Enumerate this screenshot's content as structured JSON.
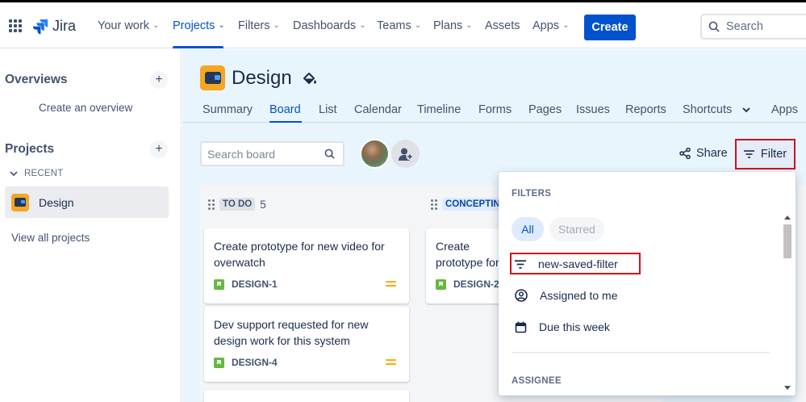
{
  "topnav": {
    "logo_text": "Jira",
    "items": [
      {
        "label": "Your work",
        "has_chevron": true
      },
      {
        "label": "Projects",
        "has_chevron": true,
        "active": true
      },
      {
        "label": "Filters",
        "has_chevron": true
      },
      {
        "label": "Dashboards",
        "has_chevron": true
      },
      {
        "label": "Teams",
        "has_chevron": true
      },
      {
        "label": "Plans",
        "has_chevron": true
      },
      {
        "label": "Assets",
        "has_chevron": false
      },
      {
        "label": "Apps",
        "has_chevron": true
      }
    ],
    "create_label": "Create",
    "search_placeholder": "Search"
  },
  "sidebar": {
    "overviews_heading": "Overviews",
    "create_overview": "Create an overview",
    "projects_heading": "Projects",
    "recent_label": "RECENT",
    "recent_project": "Design",
    "view_all": "View all projects"
  },
  "project": {
    "title": "Design",
    "tabs": [
      "Summary",
      "Board",
      "List",
      "Calendar",
      "Timeline",
      "Forms",
      "Pages",
      "Issues",
      "Reports",
      "Shortcuts",
      "Apps"
    ],
    "active_tab": "Board"
  },
  "toolbar": {
    "search_placeholder": "Search board",
    "share_label": "Share",
    "filter_label": "Filter"
  },
  "columns": [
    {
      "name": "TO DO",
      "count": "5",
      "cards": [
        {
          "title": "Create prototype for new video for overwatch",
          "key": "DESIGN-1"
        },
        {
          "title": "Dev support requested for new design work for this system",
          "key": "DESIGN-4"
        }
      ]
    },
    {
      "name": "CONCEPTING",
      "count": "",
      "cards": [
        {
          "title": "Create prototype for x game",
          "key": "DESIGN-2"
        }
      ]
    }
  ],
  "filter_dropdown": {
    "filters_heading": "FILTERS",
    "pill_all": "All",
    "pill_starred": "Starred",
    "items": [
      "new-saved-filter",
      "Assigned to me",
      "Due this week"
    ],
    "assignee_heading": "ASSIGNEE"
  },
  "colors": {
    "brand": "#0052cc",
    "board_bg": "#e9f5fc",
    "project_icon": "#f5a623",
    "highlight_outline": "#d0121b",
    "story": "#63ba3c",
    "priority_medium": "#ffab00"
  }
}
